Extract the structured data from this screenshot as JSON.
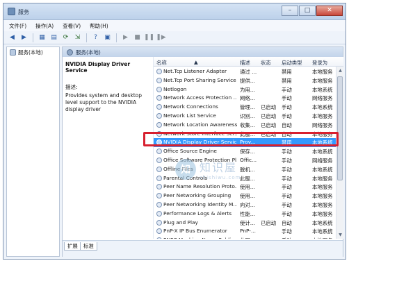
{
  "window": {
    "title": "服务"
  },
  "window_buttons": {
    "minimize": "–",
    "maximize": "□",
    "close": "✕"
  },
  "menu": [
    "文件(F)",
    "操作(A)",
    "查看(V)",
    "帮助(H)"
  ],
  "toolbar_icons": [
    "back-icon",
    "forward-icon",
    "console-tree-icon",
    "properties-icon",
    "refresh-icon",
    "export-icon",
    "help-icon",
    "mmc-icon",
    "start-icon",
    "stop-icon",
    "pause-icon",
    "restart-icon"
  ],
  "left_pane": {
    "item": "服务(本地)"
  },
  "main_header": "服务(本地)",
  "detail": {
    "service_name": "NVIDIA Display Driver Service",
    "description_label": "描述:",
    "description": "Provides system and desktop level support to the NVIDIA display driver"
  },
  "columns": [
    "名称",
    "描述",
    "状态",
    "启动类型",
    "登录为"
  ],
  "rows": [
    {
      "name": "Net.Tcp Listener Adapter",
      "desc": "通过 ...",
      "status": "",
      "startup": "禁用",
      "logon": "本地服务"
    },
    {
      "name": "Net.Tcp Port Sharing Service",
      "desc": "提供...",
      "status": "",
      "startup": "禁用",
      "logon": "本地服务"
    },
    {
      "name": "Netlogon",
      "desc": "为用...",
      "status": "",
      "startup": "手动",
      "logon": "本地系统"
    },
    {
      "name": "Network Access Protection ...",
      "desc": "网络...",
      "status": "",
      "startup": "手动",
      "logon": "网络服务"
    },
    {
      "name": "Network Connections",
      "desc": "管理...",
      "status": "已启动",
      "startup": "手动",
      "logon": "本地系统"
    },
    {
      "name": "Network List Service",
      "desc": "识别...",
      "status": "已启动",
      "startup": "手动",
      "logon": "本地服务"
    },
    {
      "name": "Network Location Awareness",
      "desc": "收集...",
      "status": "已启动",
      "startup": "自动",
      "logon": "网络服务"
    },
    {
      "name": "Network Store Interface Ser...",
      "desc": "此服...",
      "status": "已启动",
      "startup": "自动",
      "logon": "本地服务"
    },
    {
      "name": "NVIDIA Display Driver Service",
      "desc": "Prov...",
      "status": "",
      "startup": "禁用",
      "logon": "本地系统",
      "selected": true
    },
    {
      "name": "Office  Source Engine",
      "desc": "保存...",
      "status": "",
      "startup": "手动",
      "logon": "本地系统"
    },
    {
      "name": "Office Software Protection Pl...",
      "desc": "Offic...",
      "status": "",
      "startup": "手动",
      "logon": "网络服务"
    },
    {
      "name": "Offline Files",
      "desc": "脱机...",
      "status": "",
      "startup": "手动",
      "logon": "本地系统"
    },
    {
      "name": "Parental Controls",
      "desc": "此服...",
      "status": "",
      "startup": "手动",
      "logon": "本地服务"
    },
    {
      "name": "Peer Name Resolution Proto...",
      "desc": "使用...",
      "status": "",
      "startup": "手动",
      "logon": "本地服务"
    },
    {
      "name": "Peer Networking Grouping",
      "desc": "使用...",
      "status": "",
      "startup": "手动",
      "logon": "本地服务"
    },
    {
      "name": "Peer Networking Identity M...",
      "desc": "向对...",
      "status": "",
      "startup": "手动",
      "logon": "本地服务"
    },
    {
      "name": "Performance Logs & Alerts",
      "desc": "性能...",
      "status": "",
      "startup": "手动",
      "logon": "本地服务"
    },
    {
      "name": "Plug and Play",
      "desc": "使计...",
      "status": "已启动",
      "startup": "自动",
      "logon": "本地系统"
    },
    {
      "name": "PnP-X IP Bus Enumerator",
      "desc": "PnP-...",
      "status": "",
      "startup": "手动",
      "logon": "本地系统"
    },
    {
      "name": "PNRP Machine Name Public...",
      "desc": "此服...",
      "status": "",
      "startup": "手动",
      "logon": "本地服务"
    }
  ],
  "tabs": [
    "扩展",
    "标准"
  ],
  "watermark": {
    "cn": "知识屋",
    "en": "zhishiwu.com",
    "logo": "知"
  },
  "colors": {
    "selection": "#3399ff",
    "highlight_box": "#d7202f"
  }
}
